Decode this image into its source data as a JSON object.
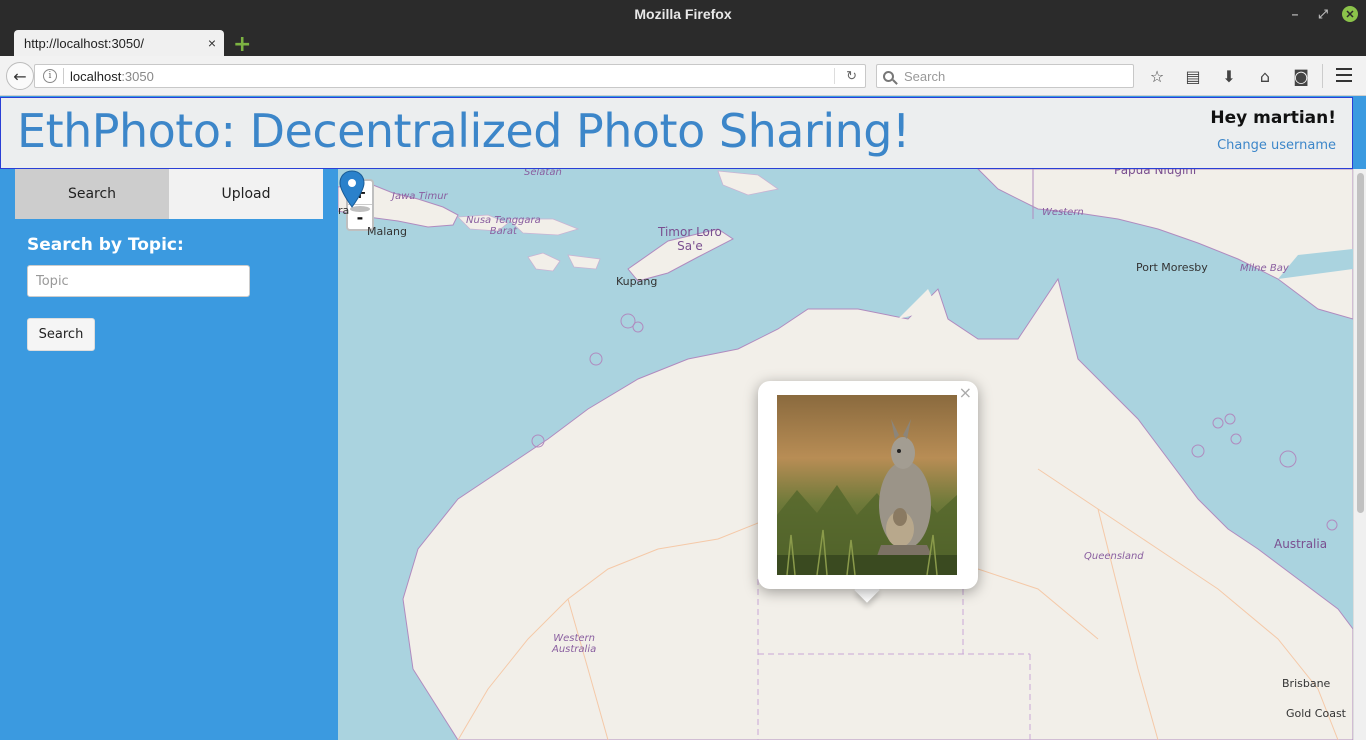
{
  "browser": {
    "window_title": "Mozilla Firefox",
    "tab_title": "http://localhost:3050/",
    "tab_close": "×",
    "new_tab": "+",
    "url_host": "localhost",
    "url_port": ":3050",
    "search_placeholder": "Search"
  },
  "header": {
    "title": "EthPhoto: Decentralized Photo Sharing!",
    "greeting": "Hey martian!",
    "change_username": "Change username"
  },
  "sidebar": {
    "tabs": [
      "Search",
      "Upload"
    ],
    "active_tab": "Search",
    "heading": "Search by Topic:",
    "topic_placeholder": "Topic",
    "topic_value": "",
    "search_button": "Search"
  },
  "map": {
    "zoom_in": "+",
    "zoom_out": "-",
    "labels": {
      "selatan": "Selatan",
      "jawa_timur": "Jawa Timur",
      "malang": "Malang",
      "ntb": "Nusa Tenggara\nBarat",
      "timor": "Timor Loro\nSa'e",
      "kupang": "Kupang",
      "papua": "Papua Niugini",
      "western": "Western",
      "port_moresby": "Port Moresby",
      "milne_bay": "Milne Bay",
      "queensland": "Queensland",
      "australia": "Australia",
      "western_australia": "Western\nAustralia",
      "brisbane": "Brisbane",
      "gold_coast": "Gold Coast",
      "ra": "ra"
    },
    "popup_close": "×",
    "colors": {
      "water": "#aad3df",
      "land": "#f2efe9",
      "border": "#b08bbf",
      "marker": "#2a81cb"
    }
  }
}
